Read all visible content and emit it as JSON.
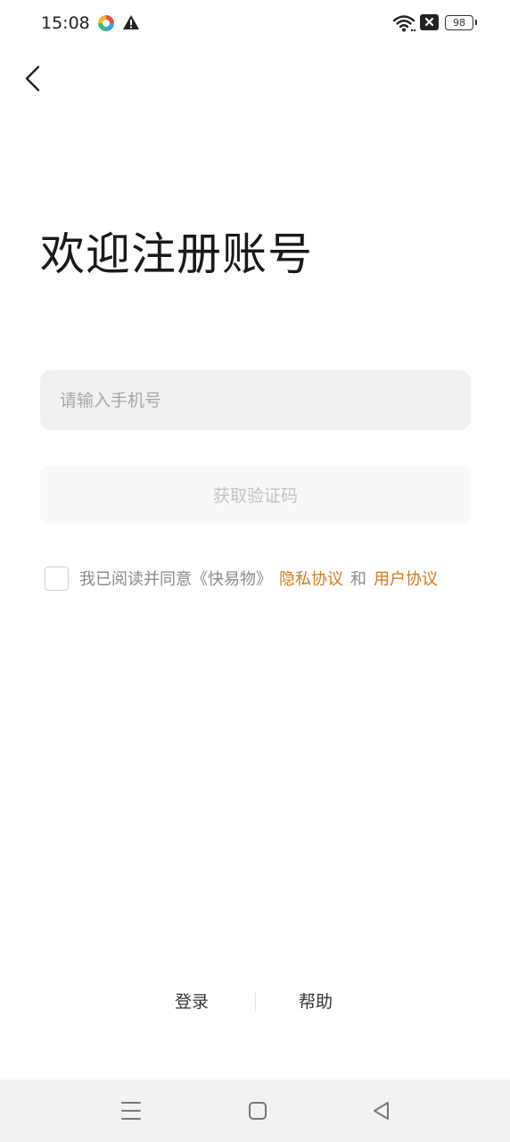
{
  "status_bar": {
    "time": "15:08",
    "battery_level": "98",
    "icons": [
      "app-notification-icon",
      "warning-icon",
      "wifi-icon",
      "no-sim-icon",
      "battery-icon"
    ]
  },
  "header": {
    "back_icon": "chevron-left-icon"
  },
  "title": "欢迎注册账号",
  "phone_input": {
    "placeholder": "请输入手机号",
    "value": ""
  },
  "get_code_button": {
    "label": "获取验证码"
  },
  "agreement": {
    "checked": false,
    "text": "我已阅读并同意《快易物》",
    "privacy_link": "隐私协议",
    "and": "和",
    "user_link": "用户协议"
  },
  "footer": {
    "login": "登录",
    "help": "帮助"
  },
  "nav_bar": {
    "icons": [
      "menu-icon",
      "home-icon",
      "back-triangle-icon"
    ]
  },
  "colors": {
    "accent": "#d67a1f",
    "input_bg": "#f1f1f1",
    "button_disabled_bg": "#f8f8f8",
    "nav_bg": "#f2f2f2"
  }
}
